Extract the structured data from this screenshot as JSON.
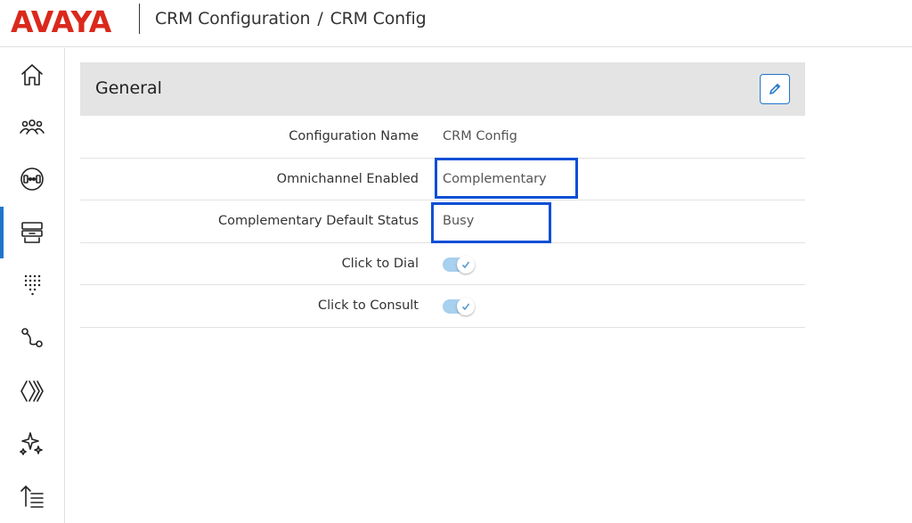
{
  "header": {
    "logo": "AVAYA",
    "breadcrumb": [
      "CRM Configuration",
      "CRM Config"
    ],
    "separator": "/"
  },
  "sidebar": {
    "items": [
      {
        "name": "home-icon",
        "active": false
      },
      {
        "name": "users-icon",
        "active": false
      },
      {
        "name": "headset-icon",
        "active": false
      },
      {
        "name": "integrations-icon",
        "active": true
      },
      {
        "name": "dialpad-icon",
        "active": false
      },
      {
        "name": "routing-icon",
        "active": false
      },
      {
        "name": "channels-icon",
        "active": false
      },
      {
        "name": "sparkles-icon",
        "active": false
      },
      {
        "name": "sort-list-icon",
        "active": false
      }
    ]
  },
  "panel": {
    "title": "General",
    "rows": [
      {
        "label": "Configuration Name",
        "value": "CRM Config",
        "type": "text"
      },
      {
        "label": "Omnichannel Enabled",
        "value": "Complementary",
        "type": "text"
      },
      {
        "label": "Complementary Default Status",
        "value": "Busy",
        "type": "text"
      },
      {
        "label": "Click to Dial",
        "value": true,
        "type": "toggle"
      },
      {
        "label": "Click to Consult",
        "value": true,
        "type": "toggle"
      }
    ]
  },
  "colors": {
    "brand": "#da291c",
    "accent": "#1f76c9",
    "highlight": "#0a4fd6",
    "toggle_track": "#a8d0ef"
  }
}
